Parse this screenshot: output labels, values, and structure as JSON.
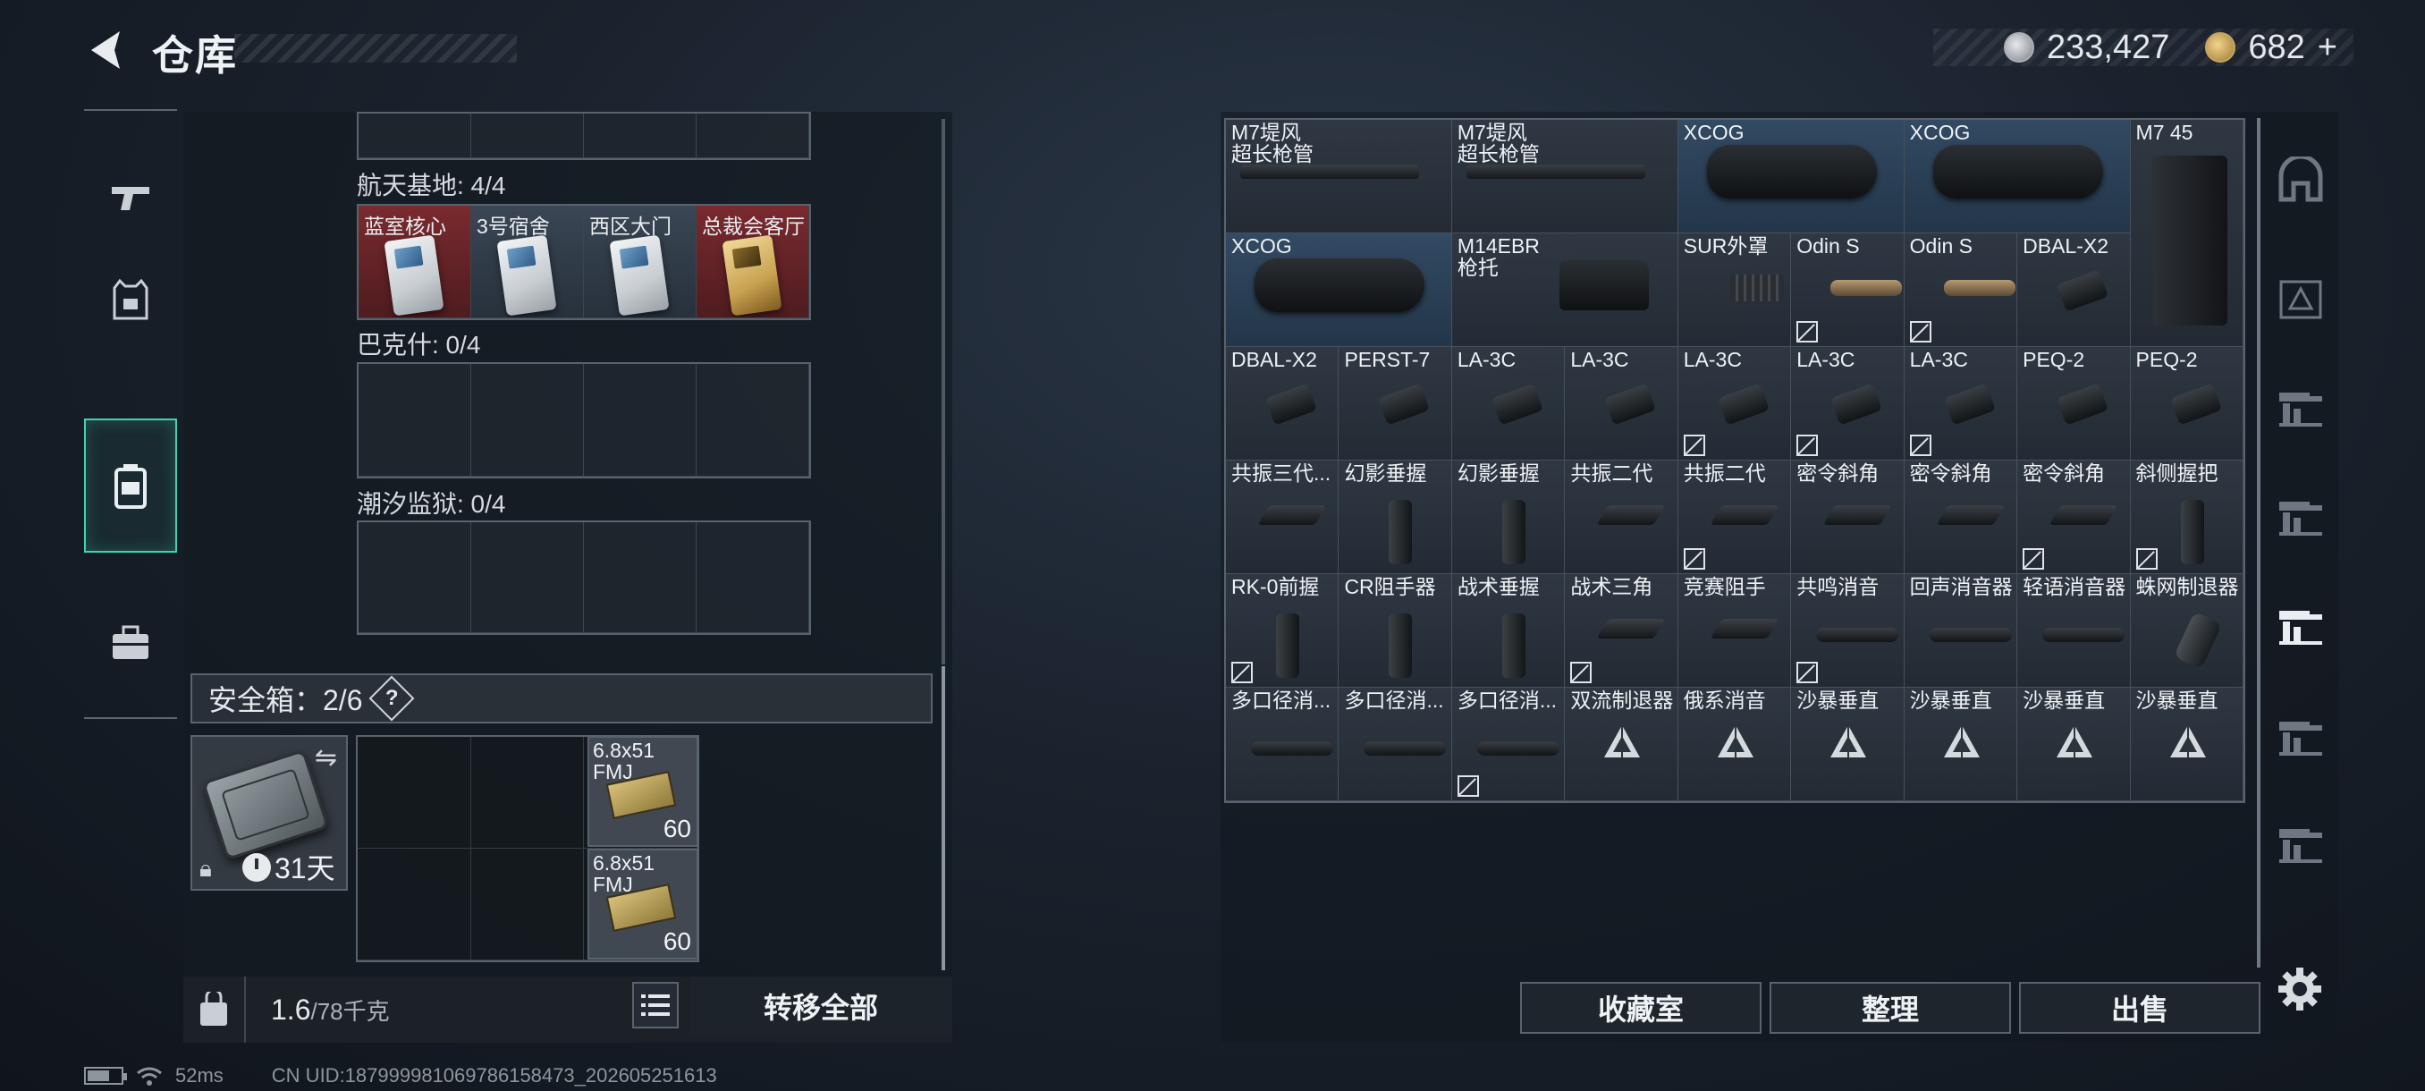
{
  "header": {
    "title": "仓库",
    "silver_amount": "233,427",
    "gold_amount": "682",
    "plus_label": "+"
  },
  "left_nav": {
    "items": [
      {
        "icon": "pistol-icon"
      },
      {
        "icon": "vest-icon"
      },
      {
        "icon": "backpack-icon",
        "active": true
      },
      {
        "icon": "case-icon"
      }
    ]
  },
  "keycards": {
    "section1_label": "航天基地: 4/4",
    "section1_cards": [
      "蓝室核心",
      "3号宿舍",
      "西区大门",
      "总裁会客厅"
    ],
    "section2_label": "巴克什: 0/4",
    "section3_label": "潮汐监狱: 0/4"
  },
  "safe_box": {
    "label": "安全箱：2/6",
    "help": "?",
    "days": "31天",
    "ammo": [
      {
        "name": "6.8x51\nFMJ",
        "count": "60"
      },
      {
        "name": "6.8x51\nFMJ",
        "count": "60"
      }
    ]
  },
  "bottom_left": {
    "weight_current": "1.6",
    "weight_max": "/78千克",
    "transfer_all": "转移全部"
  },
  "status_bar": {
    "ping": "52ms",
    "uid": "CN UID:187999981069786158473_202605251613"
  },
  "items": [
    {
      "name": "M7堤风\n超长枪管",
      "shape": "barrel"
    },
    {
      "name": "M7堤风\n超长枪管",
      "shape": "barrel"
    },
    {
      "name": "XCOG",
      "shape": "scope",
      "blue": true
    },
    {
      "name": "XCOG",
      "shape": "scope",
      "blue": true
    },
    {
      "name": "M7 45",
      "shape": "mag"
    },
    {
      "name": "XCOG",
      "shape": "scope",
      "blue": true
    },
    {
      "name": "M14EBR\n枪托",
      "shape": "stock"
    },
    {
      "name": "SUR外罩",
      "shape": "rail"
    },
    {
      "name": "Odin S",
      "shape": "light",
      "locked": true
    },
    {
      "name": "Odin S",
      "shape": "light",
      "locked": true
    },
    {
      "name": "DBAL-X2",
      "shape": "laser"
    },
    {
      "name": "DBAL-X2",
      "shape": "laser"
    },
    {
      "name": "PERST-7",
      "shape": "laser"
    },
    {
      "name": "LA-3C",
      "shape": "laser"
    },
    {
      "name": "LA-3C",
      "shape": "laser"
    },
    {
      "name": "LA-3C",
      "shape": "laser",
      "locked": true
    },
    {
      "name": "LA-3C",
      "shape": "laser",
      "locked": true
    },
    {
      "name": "LA-3C",
      "shape": "laser",
      "locked": true
    },
    {
      "name": "PEQ-2",
      "shape": "laser"
    },
    {
      "name": "PEQ-2",
      "shape": "laser"
    },
    {
      "name": "共振三代...",
      "shape": "grip-angle"
    },
    {
      "name": "幻影垂握",
      "shape": "grip-vert"
    },
    {
      "name": "幻影垂握",
      "shape": "grip-vert"
    },
    {
      "name": "共振二代",
      "shape": "grip-angle"
    },
    {
      "name": "共振二代",
      "shape": "grip-angle",
      "locked": true
    },
    {
      "name": "密令斜角",
      "shape": "grip-angle"
    },
    {
      "name": "密令斜角",
      "shape": "grip-angle"
    },
    {
      "name": "密令斜角",
      "shape": "grip-angle",
      "locked": true
    },
    {
      "name": "斜侧握把",
      "shape": "grip-vert",
      "locked": true
    },
    {
      "name": "RK-0前握",
      "shape": "grip-vert",
      "locked": true
    },
    {
      "name": "CR阻手器",
      "shape": "grip-vert"
    },
    {
      "name": "战术垂握",
      "shape": "grip-vert"
    },
    {
      "name": "战术三角",
      "shape": "grip-angle",
      "locked": true
    },
    {
      "name": "竞赛阻手",
      "shape": "grip-angle"
    },
    {
      "name": "共鸣消音",
      "shape": "suppr",
      "locked": true
    },
    {
      "name": "回声消音器",
      "shape": "suppr"
    },
    {
      "name": "轻语消音器",
      "shape": "suppr"
    },
    {
      "name": "蛛网制退器",
      "shape": "brake"
    },
    {
      "name": "多口径消...",
      "shape": "suppr"
    },
    {
      "name": "多口径消...",
      "shape": "suppr"
    },
    {
      "name": "多口径消...",
      "shape": "suppr",
      "locked": true
    },
    {
      "name": "双流制退器",
      "shape": "tri"
    },
    {
      "name": "俄系消音",
      "shape": "tri"
    },
    {
      "name": "沙暴垂直",
      "shape": "tri"
    },
    {
      "name": "沙暴垂直",
      "shape": "tri"
    },
    {
      "name": "沙暴垂直",
      "shape": "tri"
    },
    {
      "name": "沙暴垂直",
      "shape": "tri"
    }
  ],
  "right_buttons": {
    "collection": "收藏室",
    "sort": "整理",
    "sell": "出售"
  },
  "side_tabs": [
    {
      "icon": "category-icon"
    },
    {
      "icon": "scope-category-icon"
    },
    {
      "icon": "rifle-category-icon"
    },
    {
      "icon": "weapon-category-icon"
    },
    {
      "icon": "attachment-category-icon",
      "active": true
    },
    {
      "icon": "ammo-category-icon"
    },
    {
      "icon": "ammo-box-category-icon"
    }
  ]
}
